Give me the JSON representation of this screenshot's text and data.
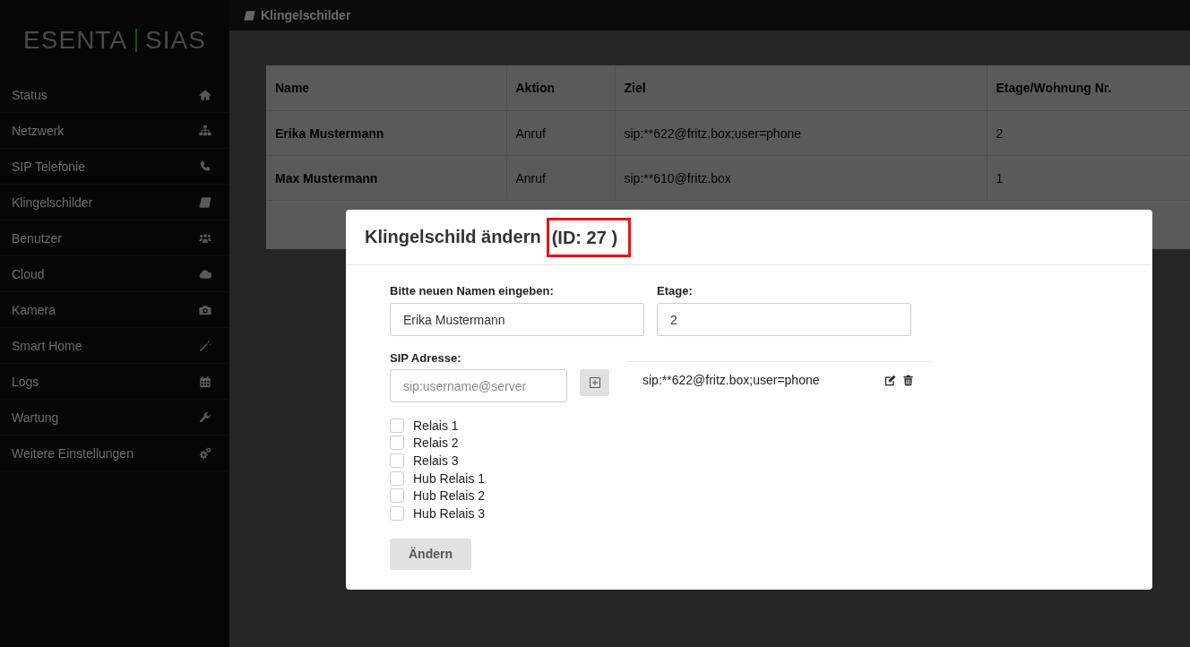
{
  "top_bar": {
    "title": "Klingelschilder"
  },
  "sidebar": {
    "logo": {
      "left": "ESENTA",
      "right": "SIAS"
    },
    "items": [
      {
        "label": "Status"
      },
      {
        "label": "Netzwerk"
      },
      {
        "label": "SIP Telefonie"
      },
      {
        "label": "Klingelschilder"
      },
      {
        "label": "Benutzer"
      },
      {
        "label": "Cloud"
      },
      {
        "label": "Kamera"
      },
      {
        "label": "Smart Home"
      },
      {
        "label": "Logs"
      },
      {
        "label": "Wartung"
      },
      {
        "label": "Weitere Einstellungen"
      }
    ]
  },
  "table": {
    "columns": [
      "Name",
      "Aktion",
      "Ziel",
      "Etage/Wohnung Nr."
    ],
    "rows": [
      [
        "Erika Mustermann",
        "Anruf",
        "sip:**622@fritz.box;user=phone",
        "2"
      ],
      [
        "Max Mustermann",
        "Anruf",
        "sip:**610@fritz.box",
        "1"
      ]
    ]
  },
  "modal": {
    "title": "Klingelschild ändern",
    "record_id": "(ID: 27 )",
    "record_id_highlighted": true,
    "name_field": {
      "label": "Bitte neuen Namen eingeben:",
      "value": "Erika Mustermann"
    },
    "floor_field": {
      "label": "Etage:",
      "value": "2"
    },
    "sip_field": {
      "label": "SIP Adresse:",
      "placeholder": "sip:username@server"
    },
    "sip_entries": [
      {
        "address": "sip:**622@fritz.box;user=phone"
      }
    ],
    "relays": [
      {
        "label": "Relais 1",
        "checked": false
      },
      {
        "label": "Relais 2",
        "checked": false
      },
      {
        "label": "Relais 3",
        "checked": false
      },
      {
        "label": "Hub Relais 1",
        "checked": false
      },
      {
        "label": "Hub Relais 2",
        "checked": false
      },
      {
        "label": "Hub Relais 3",
        "checked": false
      }
    ],
    "submit_button": "Ändern"
  }
}
